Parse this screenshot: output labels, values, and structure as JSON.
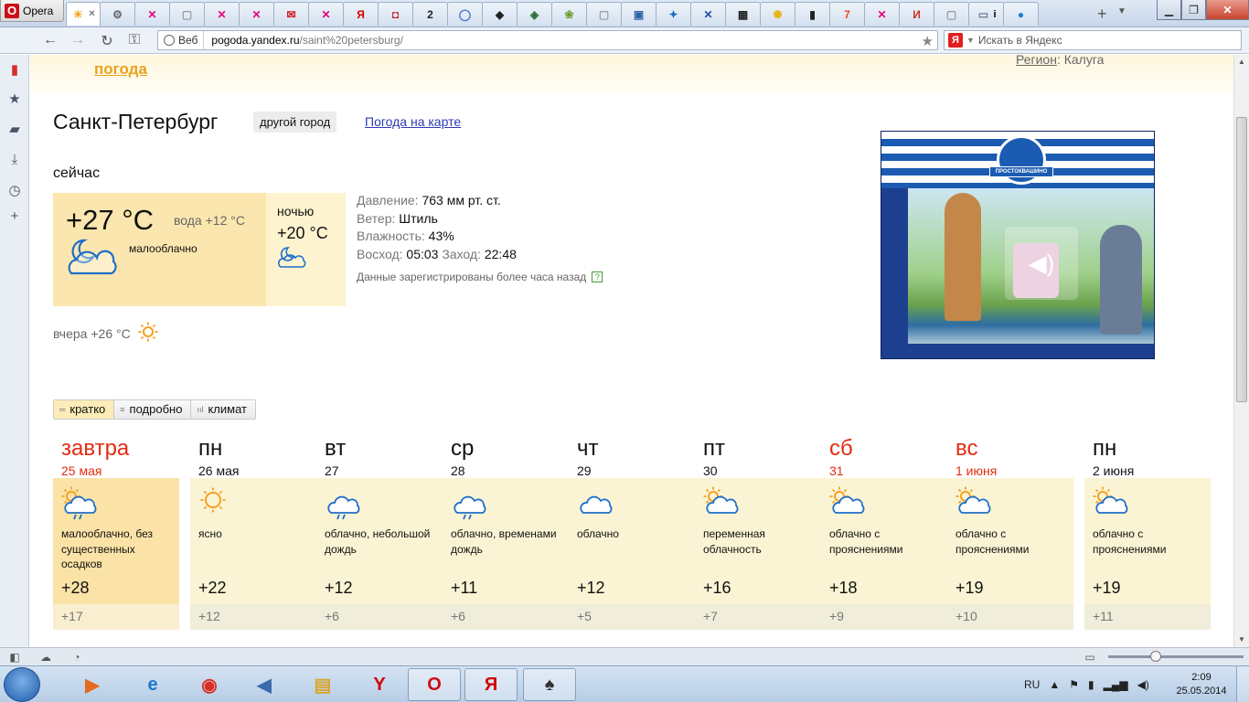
{
  "browser": {
    "menu_label": "Opera",
    "tabs": [
      {
        "icon": "yandex-weather-icon",
        "glyph": "☀",
        "color": "#f7a21b",
        "active": true
      },
      {
        "icon": "tool-icon",
        "glyph": "⚙",
        "color": "#666"
      },
      {
        "icon": "odnoklassniki-icon",
        "glyph": "✕",
        "color": "#e6007e"
      },
      {
        "icon": "page-icon",
        "glyph": "▢",
        "color": "#999"
      },
      {
        "icon": "odnoklassniki-icon",
        "glyph": "✕",
        "color": "#e6007e"
      },
      {
        "icon": "odnoklassniki-icon",
        "glyph": "✕",
        "color": "#e6007e"
      },
      {
        "icon": "mail-icon",
        "glyph": "✉",
        "color": "#d4141b"
      },
      {
        "icon": "odnoklassniki-icon",
        "glyph": "✕",
        "color": "#e6007e"
      },
      {
        "icon": "yandex-icon",
        "glyph": "Я",
        "color": "#d40000"
      },
      {
        "icon": "red-logo-icon",
        "glyph": "◘",
        "color": "#c4161c"
      },
      {
        "icon": "two-icon",
        "glyph": "2",
        "color": "#222"
      },
      {
        "icon": "chat-icon",
        "glyph": "◯",
        "color": "#3a6fc4"
      },
      {
        "icon": "cat-icon",
        "glyph": "◆",
        "color": "#222"
      },
      {
        "icon": "diamond-icon",
        "glyph": "◈",
        "color": "#2c6f3b"
      },
      {
        "icon": "leaf-icon",
        "glyph": "❀",
        "color": "#6b9e2a"
      },
      {
        "icon": "page-icon",
        "glyph": "▢",
        "color": "#999"
      },
      {
        "icon": "window-icon",
        "glyph": "▣",
        "color": "#2f5fa8"
      },
      {
        "icon": "bird-icon",
        "glyph": "✦",
        "color": "#1e6dc2"
      },
      {
        "icon": "cross-icon",
        "glyph": "✕",
        "color": "#1e50a2"
      },
      {
        "icon": "wallet-icon",
        "glyph": "▦",
        "color": "#222"
      },
      {
        "icon": "sun-face-icon",
        "glyph": "✺",
        "color": "#e8b51a"
      },
      {
        "icon": "film-icon",
        "glyph": "▮",
        "color": "#222"
      },
      {
        "icon": "seven-icon",
        "glyph": "7",
        "color": "#e74b1c"
      },
      {
        "icon": "odnoklassniki-icon",
        "glyph": "✕",
        "color": "#e6007e"
      },
      {
        "icon": "letter-i-icon",
        "glyph": "И",
        "color": "#c8321e"
      },
      {
        "icon": "page-icon",
        "glyph": "▢",
        "color": "#999"
      },
      {
        "icon": "image-icon",
        "glyph": "▭",
        "color": "#6e7c92"
      },
      {
        "icon": "drop-icon",
        "glyph": "●",
        "color": "#1e7fd0"
      }
    ],
    "tab_i_label": "i",
    "address": {
      "scope_label": "Веб",
      "host": "pogoda.yandex.ru",
      "path": "/saint%20petersburg/"
    },
    "search_placeholder": "Искать в Яндекс",
    "search_engine_label": "Я"
  },
  "page": {
    "header_link": "погода",
    "region_label": "Регион",
    "region_value": "Калуга",
    "city": "Санкт-Петербург",
    "other_city_button": "другой город",
    "map_link": "Погода на карте",
    "now": {
      "label": "сейчас",
      "temp": "+27 °C",
      "water": "вода +12 °C",
      "condition": "малооблачно",
      "icon": "moon-cloud-icon",
      "night_label": "ночью",
      "night_temp": "+20 °C",
      "night_icon": "moon-cloud-icon"
    },
    "details": {
      "pressure_label": "Давление:",
      "pressure_value": "763 мм рт. ст.",
      "wind_label": "Ветер:",
      "wind_value": "Штиль",
      "humidity_label": "Влажность:",
      "humidity_value": "43%",
      "sunrise_label": "Восход:",
      "sunrise_value": "05:03",
      "sunset_label": "Заход:",
      "sunset_value": "22:48",
      "note": "Данные зарегистрированы более часа назад",
      "help": "?"
    },
    "yesterday": "вчера +26 °C",
    "view_tabs": [
      {
        "label": "кратко",
        "glyph": "═",
        "active": true
      },
      {
        "label": "подробно",
        "glyph": "≡",
        "active": false
      },
      {
        "label": "климат",
        "glyph": "ııl",
        "active": false
      }
    ],
    "forecast": [
      {
        "day": "завтра",
        "date": "25 мая",
        "red": true,
        "highlight": true,
        "icon": "sun-cloud-rain-icon",
        "desc": "малооблачно, без существенных осадков",
        "max": "+28",
        "min": "+17"
      },
      {
        "day": "пн",
        "date": "26 мая",
        "red": false,
        "highlight": false,
        "icon": "sun-icon",
        "desc": "ясно",
        "max": "+22",
        "min": "+12"
      },
      {
        "day": "вт",
        "date": "27",
        "red": false,
        "highlight": false,
        "icon": "cloud-rain-icon",
        "desc": "облачно, небольшой дождь",
        "max": "+12",
        "min": "+6"
      },
      {
        "day": "ср",
        "date": "28",
        "red": false,
        "highlight": false,
        "icon": "cloud-rain-icon",
        "desc": "облачно, временами дождь",
        "max": "+11",
        "min": "+6"
      },
      {
        "day": "чт",
        "date": "29",
        "red": false,
        "highlight": false,
        "icon": "cloud-icon",
        "desc": "облачно",
        "max": "+12",
        "min": "+5"
      },
      {
        "day": "пт",
        "date": "30",
        "red": false,
        "highlight": false,
        "icon": "sun-cloud-icon",
        "desc": "переменная облачность",
        "max": "+16",
        "min": "+7"
      },
      {
        "day": "сб",
        "date": "31",
        "red": true,
        "highlight": false,
        "icon": "sun-cloud-icon",
        "desc": "облачно с прояснениями",
        "max": "+18",
        "min": "+9"
      },
      {
        "day": "вс",
        "date": "1 июня",
        "red": true,
        "highlight": false,
        "icon": "sun-cloud-icon",
        "desc": "облачно с прояснениями",
        "max": "+19",
        "min": "+10"
      },
      {
        "day": "пн",
        "date": "2 июня",
        "red": false,
        "highlight": false,
        "icon": "sun-cloud-icon",
        "desc": "облачно с прояснениями",
        "max": "+19",
        "min": "+11"
      }
    ],
    "ad_brand": "ПРОСТОКВАШИНО"
  },
  "taskbar": {
    "apps": [
      {
        "name": "media-player-app",
        "glyph": "▶",
        "color": "#e36b1d",
        "open": false
      },
      {
        "name": "internet-explorer-app",
        "glyph": "e",
        "color": "#1e78d4",
        "open": false
      },
      {
        "name": "chrome-app",
        "glyph": "◉",
        "color": "#d93025",
        "open": false
      },
      {
        "name": "volume-app",
        "glyph": "◀",
        "color": "#3a6aa8",
        "open": false
      },
      {
        "name": "explorer-app",
        "glyph": "▤",
        "color": "#d9a52c",
        "open": false
      },
      {
        "name": "yandex-browser-app",
        "glyph": "Y",
        "color": "#d40000",
        "open": false
      },
      {
        "name": "opera-app",
        "glyph": "O",
        "color": "#cc0f16",
        "open": true
      },
      {
        "name": "yandex-app",
        "glyph": "Я",
        "color": "#d40000",
        "open": true
      },
      {
        "name": "solitaire-app",
        "glyph": "♠",
        "color": "#333",
        "open": true
      }
    ],
    "language": "RU",
    "time": "2:09",
    "date": "25.05.2014"
  }
}
